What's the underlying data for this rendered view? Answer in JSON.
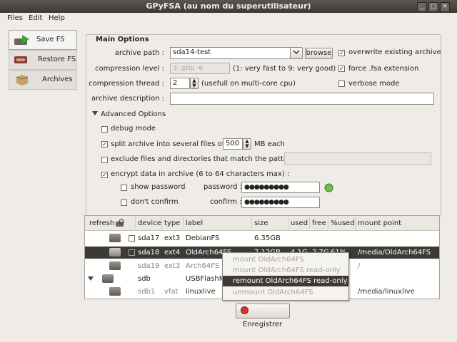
{
  "window": {
    "title": "GPyFSA (au nom du superutilisateur)"
  },
  "menu": [
    "Files",
    "Edit",
    "Help"
  ],
  "sidebar": {
    "items": [
      {
        "label": "Save FS",
        "icon": "save-fs-icon",
        "active": true
      },
      {
        "label": "Restore FS",
        "icon": "restore-fs-icon",
        "active": false
      },
      {
        "label": "Archives",
        "icon": "archives-icon",
        "active": false
      }
    ]
  },
  "main_options": {
    "title": "Main Options",
    "archive_path_label": "archive path :",
    "archive_path_value": "sda14-test",
    "browse_label": "browse",
    "overwrite_label": "overwrite existing archive",
    "compression_level_label": "compression level :",
    "compression_level_value": "3: gzip  -6",
    "compression_level_hint": "(1: very fast to 9: very good)",
    "force_ext_label": "force .fsa extension",
    "compression_thread_label": "compression thread :",
    "compression_thread_value": "2",
    "compression_thread_hint": "(usefull on multi-core cpu)",
    "verbose_label": "verbose mode",
    "description_label": "archive description :",
    "description_value": ""
  },
  "advanced": {
    "title": "Advanced Options",
    "debug_label": "debug mode",
    "split_label": "split archive into several files of :",
    "split_value": "500",
    "split_unit": "MB each",
    "exclude_label": "exclude files and directories that match the pattern :",
    "encrypt_label": "encrypt data in archive (6 to 64 characters max) :",
    "show_password_label": "show password",
    "dont_confirm_label": "don't confirm",
    "password_label": "password :",
    "password_value": "●●●●●●●●●",
    "confirm_label": "confirm :",
    "confirm_value": "●●●●●●●●●"
  },
  "table": {
    "headers": [
      "refresh",
      "device",
      "type",
      "label",
      "size",
      "used",
      "free",
      "%used",
      "mount point"
    ],
    "rows": [
      {
        "device": "sda17",
        "type": "ext3",
        "label": "DebianFS",
        "size": "6.35GB",
        "used": "",
        "free": "",
        "pct": "",
        "mount": ""
      },
      {
        "device": "sda18",
        "type": "ext4",
        "label": "OldArch64FS",
        "size": "7.12GB",
        "used": "4.1G",
        "free": "2.7G",
        "pct": "61%",
        "mount": "/media/OldArch64FS"
      },
      {
        "device": "sda19",
        "type": "ext3",
        "label": "Arch64FS",
        "size": "",
        "used": "",
        "free": "",
        "pct": "",
        "mount": "/"
      },
      {
        "device": "sdb",
        "type": "",
        "label": "USBFlashM",
        "size": "",
        "used": "",
        "free": "",
        "pct": "",
        "mount": ""
      },
      {
        "device": "sdb1",
        "type": "vfat",
        "label": "linuxlive",
        "size": "",
        "used": "",
        "free": "",
        "pct": "",
        "mount": "/media/linuxlive"
      }
    ]
  },
  "context_menu": [
    "mount OldArch64FS",
    "mount OldArch64FS read-only",
    "remount OldArch64FS read-only",
    "unmount OldArch64FS"
  ],
  "action_button": "Enregistrer"
}
